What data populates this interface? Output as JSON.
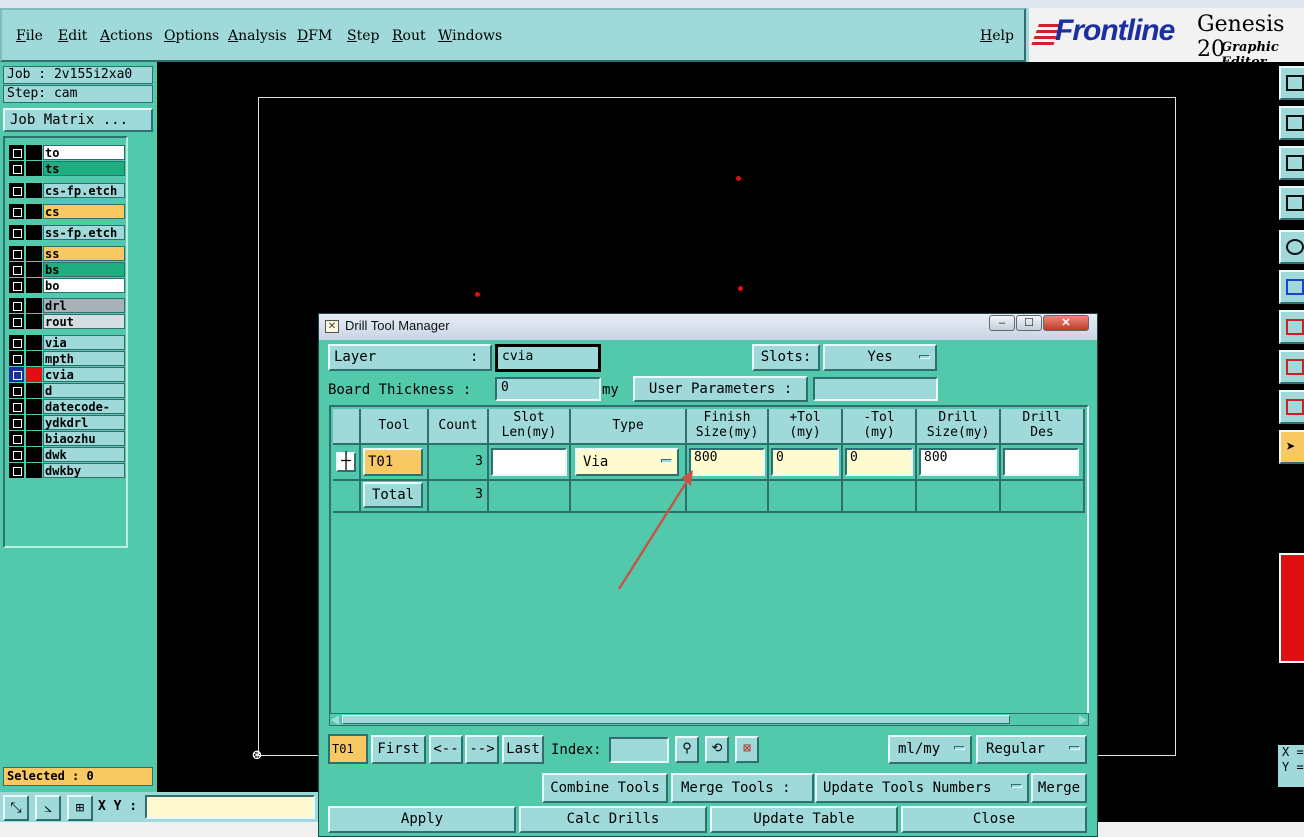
{
  "menubar": {
    "items": [
      "File",
      "Edit",
      "Actions",
      "Options",
      "Analysis",
      "DFM",
      "Step",
      "Rout",
      "Windows"
    ],
    "help": "Help"
  },
  "logo": {
    "brand": "Frontline",
    "product": "Genesis 20",
    "subtitle": "Graphic Editor"
  },
  "left": {
    "job": "Job : 2v155i2xa0",
    "step": "Step: cam",
    "job_matrix": "Job Matrix ...",
    "layers": [
      {
        "name": "to",
        "bg": "#ffffff"
      },
      {
        "name": "ts",
        "bg": "#1fae7f"
      },
      {
        "name": "cs-fp.etch",
        "bg": "#9fd9d9"
      },
      {
        "name": "cs",
        "bg": "#f8c862"
      },
      {
        "name": "ss-fp.etch",
        "bg": "#9fd9d9"
      },
      {
        "name": "ss",
        "bg": "#f8c862"
      },
      {
        "name": "bs",
        "bg": "#1fae7f"
      },
      {
        "name": "bo",
        "bg": "#ffffff"
      },
      {
        "name": "drl",
        "bg": "#a8b0b8"
      },
      {
        "name": "rout",
        "bg": "#d8dde2"
      },
      {
        "name": "via",
        "bg": "#9fd9d9"
      },
      {
        "name": "mpth",
        "bg": "#9fd9d9"
      },
      {
        "name": "cvia",
        "bg": "#9fd9d9"
      },
      {
        "name": "d",
        "bg": "#9fd9d9"
      },
      {
        "name": "datecode-to",
        "bg": "#9fd9d9"
      },
      {
        "name": "ydkdrl",
        "bg": "#9fd9d9"
      },
      {
        "name": "biaozhu",
        "bg": "#9fd9d9"
      },
      {
        "name": "dwk",
        "bg": "#9fd9d9"
      },
      {
        "name": "dwkby",
        "bg": "#9fd9d9"
      }
    ],
    "selected": "Selected : 0"
  },
  "statusbar": {
    "xy_label": "X Y :",
    "xy_value": ""
  },
  "right": {
    "x_label": "X =",
    "y_label": "Y ="
  },
  "dialog": {
    "title": "Drill Tool Manager",
    "layer_label": "Layer",
    "layer_colon": ":",
    "layer_value": "cvia",
    "slots_label": "Slots:",
    "slots_value": "Yes",
    "thickness_label": "Board Thickness :",
    "thickness_value": "0",
    "thickness_unit": "my",
    "user_params_label": "User Parameters :",
    "user_params_value": "",
    "columns": {
      "tool": "Tool",
      "count": "Count",
      "slot_len": [
        "Slot",
        "Len(my)"
      ],
      "type": "Type",
      "finish": [
        "Finish",
        "Size(my)"
      ],
      "ptol": [
        "+Tol",
        "(my)"
      ],
      "ntol": [
        "-Tol",
        "(my)"
      ],
      "drill": [
        "Drill",
        "Size(my)"
      ],
      "drill_des": [
        "Drill",
        "Des"
      ]
    },
    "row": {
      "tool": "T01",
      "count": "3",
      "slot_len": "",
      "type": "Via",
      "finish": "800",
      "ptol": "0",
      "ntol": "0",
      "drill": "800",
      "drill_des": ""
    },
    "total": {
      "label": "Total",
      "count": "3"
    },
    "nav": {
      "current": "T01",
      "first": "First",
      "prev": "<--",
      "next": "-->",
      "last": "Last",
      "index_label": "Index:",
      "index_value": "",
      "units": "ml/my",
      "mode": "Regular"
    },
    "tools": {
      "combine": "Combine Tools",
      "merge_label": "Merge Tools :",
      "merge_option": "Update Tools Numbers",
      "merge": "Merge"
    },
    "actions": {
      "apply": "Apply",
      "calc": "Calc Drills",
      "update": "Update Table",
      "close": "Close"
    }
  }
}
